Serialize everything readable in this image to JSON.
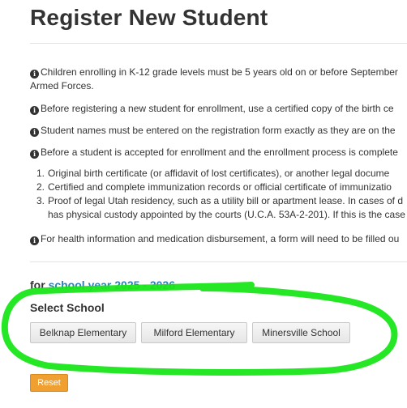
{
  "page": {
    "title": "Register New Student"
  },
  "info": {
    "items": [
      {
        "line1": "Children enrolling in K-12 grade levels must be 5 years old on or before September",
        "line2": "Armed Forces."
      },
      {
        "line1": "Before registering a new student for enrollment, use a certified copy of the birth ce"
      },
      {
        "line1": "Student names must be entered on the registration form exactly as they are on the"
      },
      {
        "line1": "Before a student is accepted for enrollment and the enrollment process is complete"
      }
    ],
    "requirements": [
      {
        "num": "1.",
        "line1": "Original birth certificate (or affidavit of lost certificates), or another legal docume"
      },
      {
        "num": "2.",
        "line1": "Certified and complete immunization records or official certificate of immunizatio"
      },
      {
        "num": "3.",
        "line1": "Proof of legal Utah residency, such as a utility bill or apartment lease. In cases of d",
        "line2": "has physical custody appointed by the courts (U.C.A. 53A-2-201). If this is the case"
      }
    ],
    "health": "For health information and medication disbursement, a form will need to be filled ou"
  },
  "school_year": {
    "prefix": "for",
    "label": "school year 2025 - 2026"
  },
  "select_school": {
    "label": "Select School",
    "options": [
      "Belknap Elementary",
      "Milford Elementary",
      "Minersville School"
    ]
  },
  "actions": {
    "reset_label": "Reset"
  },
  "colors": {
    "accent_link": "#2f7fb4",
    "reset_button": "#f0a030",
    "highlight_marker": "#19e619"
  }
}
